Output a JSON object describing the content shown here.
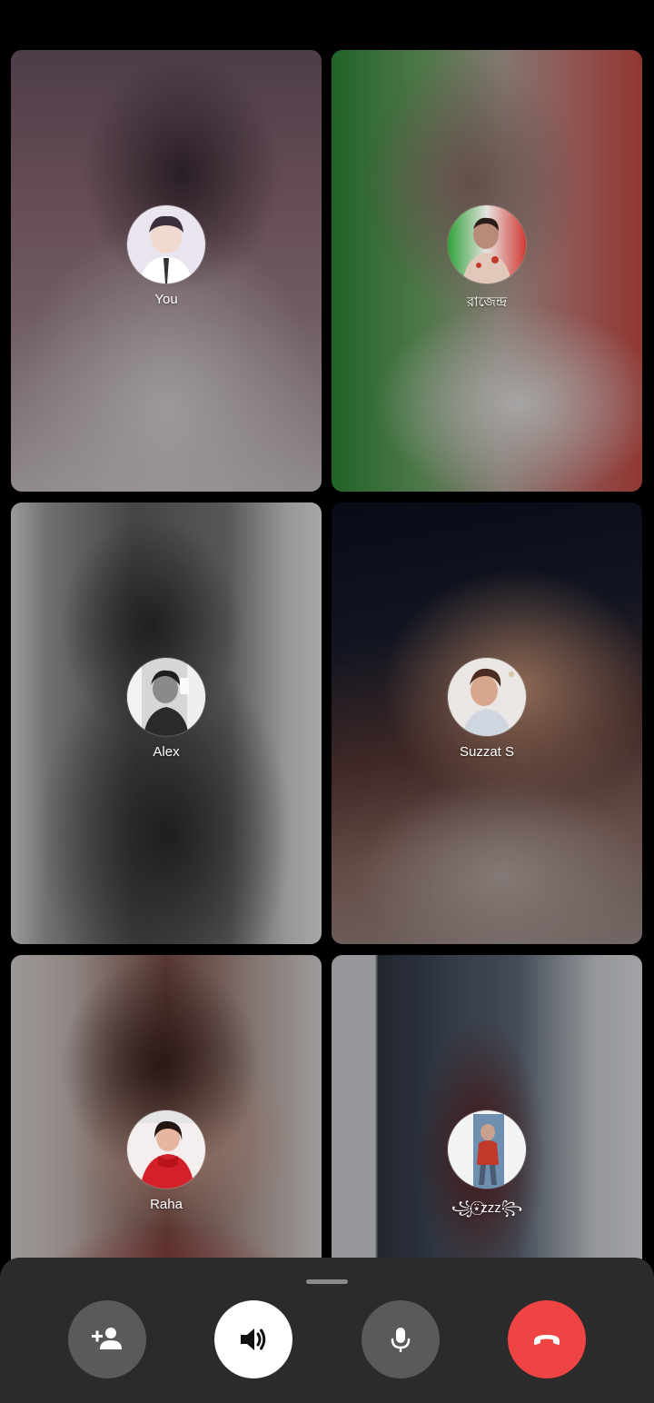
{
  "participants": [
    {
      "name": "You"
    },
    {
      "name": "রাজেন্দ্র"
    },
    {
      "name": "Alex"
    },
    {
      "name": "Suzzat S"
    },
    {
      "name": "Raha"
    },
    {
      "name": "꧁⍣⃝ᴢᴢᴢ꧂"
    }
  ],
  "controls": {
    "add_icon": "add-person-icon",
    "speaker_icon": "speaker-icon",
    "mic_icon": "microphone-icon",
    "end_icon": "end-call-icon"
  },
  "colors": {
    "sheet_bg": "#2b2b2b",
    "neutral_button": "#5a5a5a",
    "speaker_button": "#ffffff",
    "end_call": "#ef4444"
  }
}
